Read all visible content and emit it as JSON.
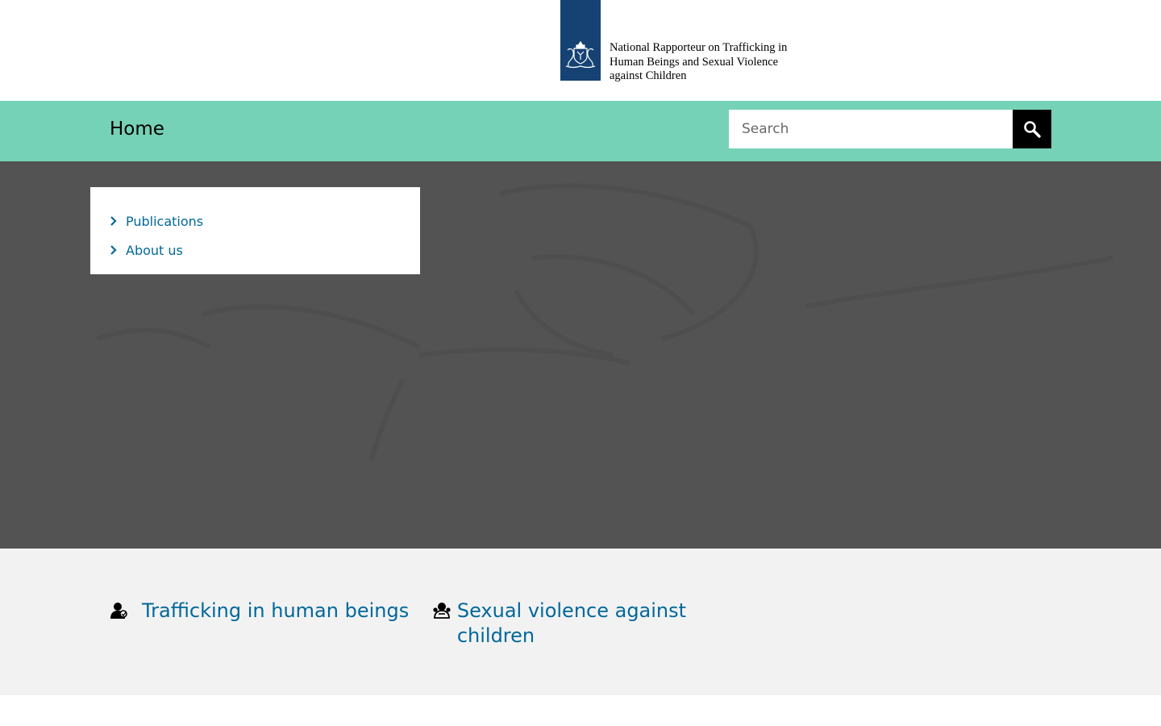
{
  "header": {
    "logo_lines": [
      "National Rapporteur on Trafficking in",
      "Human Beings and Sexual Violence",
      "against Children"
    ],
    "logo_icon": "coat-of-arms-icon"
  },
  "nav": {
    "home_label": "Home",
    "search": {
      "placeholder": "Search",
      "value": "",
      "button_icon": "search-icon"
    }
  },
  "hero_menu": {
    "items": [
      {
        "label": "Publications",
        "icon": "chevron-right-icon"
      },
      {
        "label": "About us",
        "icon": "chevron-right-icon"
      }
    ]
  },
  "topics": [
    {
      "label": "Trafficking in human beings",
      "icon": "trafficking-icon"
    },
    {
      "label": "Sexual violence against children",
      "icon": "child-protection-icon"
    }
  ],
  "colors": {
    "logo_blue": "#154273",
    "nav_mint": "#76d2b6",
    "hero_grey": "#535353",
    "link_blue": "#01689b",
    "topics_bg": "#f2f2f2"
  }
}
